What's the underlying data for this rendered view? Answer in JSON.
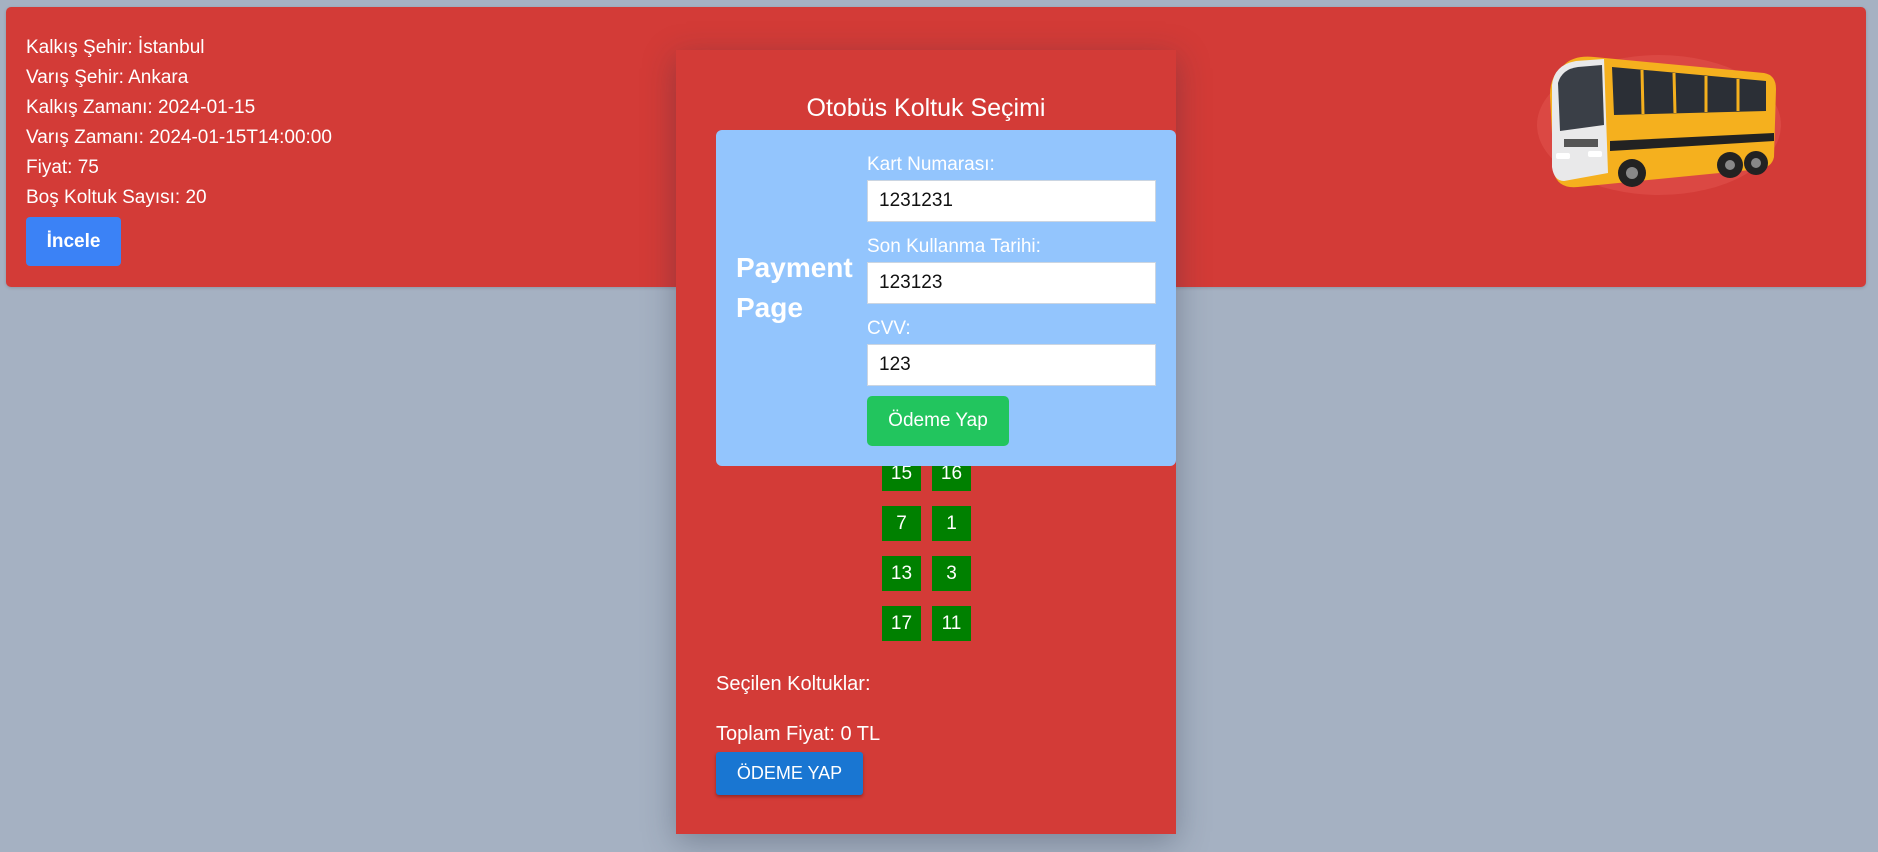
{
  "trip": {
    "departure_city": "Kalkış Şehir: İstanbul",
    "arrival_city": "Varış Şehir: Ankara",
    "departure_time": "Kalkış Zamanı: 2024-01-15",
    "arrival_time": "Varış Zamanı: 2024-01-15T14:00:00",
    "price": "Fiyat: 75",
    "empty_seats": "Boş Koltuk Sayısı: 20",
    "inspect_button": "İncele"
  },
  "bus_image": {
    "icon": "bus-image",
    "colors": {
      "body": "#f5b01e",
      "window": "#3a3f47",
      "stripe": "#222222"
    }
  },
  "seat_selection": {
    "title": "Otobüs Koltuk Seçimi",
    "seats": [
      "15",
      "16",
      "7",
      "1",
      "13",
      "3",
      "17",
      "11"
    ],
    "selected_label": "Seçilen Koltuklar:",
    "total_label": "Toplam Fiyat: 0 TL",
    "pay_button": "ÖDEME YAP"
  },
  "payment": {
    "title": "Payment Page",
    "card_number_label": "Kart Numarası:",
    "card_number_value": "1231231",
    "expiry_label": "Son Kullanma Tarihi:",
    "expiry_value": "123123",
    "cvv_label": "CVV:",
    "cvv_value": "123",
    "submit_button": "Ödeme Yap"
  },
  "colors": {
    "page_bg": "#a5b1c2",
    "card_red": "#d33b37",
    "incele_blue": "#3b82f6",
    "seat_green": "#008000",
    "payment_bg": "#93c5fd",
    "pay_green": "#22c55e",
    "pay_blue": "#1976d2"
  }
}
